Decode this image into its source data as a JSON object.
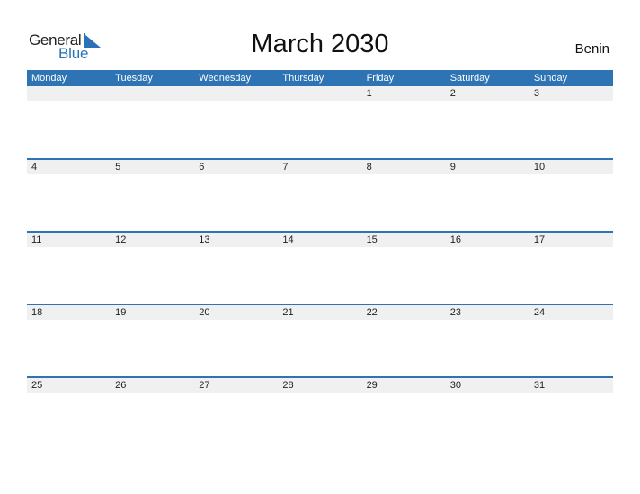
{
  "logo": {
    "general": "General",
    "blue": "Blue",
    "icon": "blue-triangle-logo-mark"
  },
  "title": "March 2030",
  "country": "Benin",
  "colors": {
    "accent": "#2e73b3",
    "date_strip": "#f0f0f0"
  },
  "weekdays": [
    "Monday",
    "Tuesday",
    "Wednesday",
    "Thursday",
    "Friday",
    "Saturday",
    "Sunday"
  ],
  "weeks": [
    [
      "",
      "",
      "",
      "",
      "1",
      "2",
      "3"
    ],
    [
      "4",
      "5",
      "6",
      "7",
      "8",
      "9",
      "10"
    ],
    [
      "11",
      "12",
      "13",
      "14",
      "15",
      "16",
      "17"
    ],
    [
      "18",
      "19",
      "20",
      "21",
      "22",
      "23",
      "24"
    ],
    [
      "25",
      "26",
      "27",
      "28",
      "29",
      "30",
      "31"
    ]
  ]
}
